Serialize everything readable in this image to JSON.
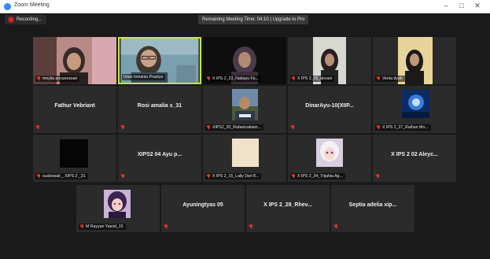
{
  "window": {
    "title": "Zoom Meeting",
    "controls": {
      "minimize": "–",
      "maximize": "□",
      "close": "✕"
    }
  },
  "topbar": {
    "recording_label": "Recording...",
    "banner": "Remaining Meeting Time: 04:10 | Upgrade to Pro"
  },
  "colors": {
    "background": "#1a1a1a",
    "tile": "#2b2b2b",
    "active_speaker": "#c7e34a",
    "muted": "#e0392b"
  },
  "participants": [
    {
      "id": "p1",
      "name": "meylia ancanessari",
      "muted": true,
      "video": true
    },
    {
      "id": "p2",
      "name": "Intan Ismania Prastya",
      "muted": false,
      "video": true,
      "active_speaker": true
    },
    {
      "id": "p3",
      "name": "X IPS 2_23_Nabayu Fa...",
      "muted": true,
      "video": true
    },
    {
      "id": "p4",
      "name": "X IPS 2_06_devani",
      "muted": true,
      "video": true
    },
    {
      "id": "p5",
      "name": "Venia dyah",
      "muted": true,
      "video": true
    },
    {
      "id": "p6",
      "name": "Fathur Vebriant",
      "muted": true,
      "video": false
    },
    {
      "id": "p7",
      "name": "Rosi amalia s_31",
      "muted": true,
      "video": false
    },
    {
      "id": "p8",
      "name": "XIPS2_20_Rafaelzakiam...",
      "muted": true,
      "video": true
    },
    {
      "id": "p9",
      "name": "DinarAyu-10(XIIP...",
      "muted": true,
      "video": false
    },
    {
      "id": "p10",
      "name": "X IPS 2_27_Raihan Mo...",
      "muted": true,
      "video": true
    },
    {
      "id": "p11",
      "name": "susilowati _ XIPS 2 _31",
      "muted": true,
      "video": true
    },
    {
      "id": "p12",
      "name": "XIPS2 04 Ayu p...",
      "muted": true,
      "video": false
    },
    {
      "id": "p13",
      "name": "X IPS 2_15_Laily Dwi R...",
      "muted": true,
      "video": true
    },
    {
      "id": "p14",
      "name": "X IPS 2_34_Trijahia Ag...",
      "muted": true,
      "video": true
    },
    {
      "id": "p15",
      "name": "X IPS 2 02 Aleyc...",
      "muted": true,
      "video": false
    },
    {
      "id": "p16",
      "name": "M Rayyan Yasrid_15",
      "muted": true,
      "video": true
    },
    {
      "id": "p17",
      "name": "Ayuningtyas 05",
      "muted": true,
      "video": false
    },
    {
      "id": "p18",
      "name": "X IPS 2_29_Rhev...",
      "muted": true,
      "video": false
    },
    {
      "id": "p19",
      "name": "Septia adelia xip...",
      "muted": true,
      "video": false
    }
  ]
}
